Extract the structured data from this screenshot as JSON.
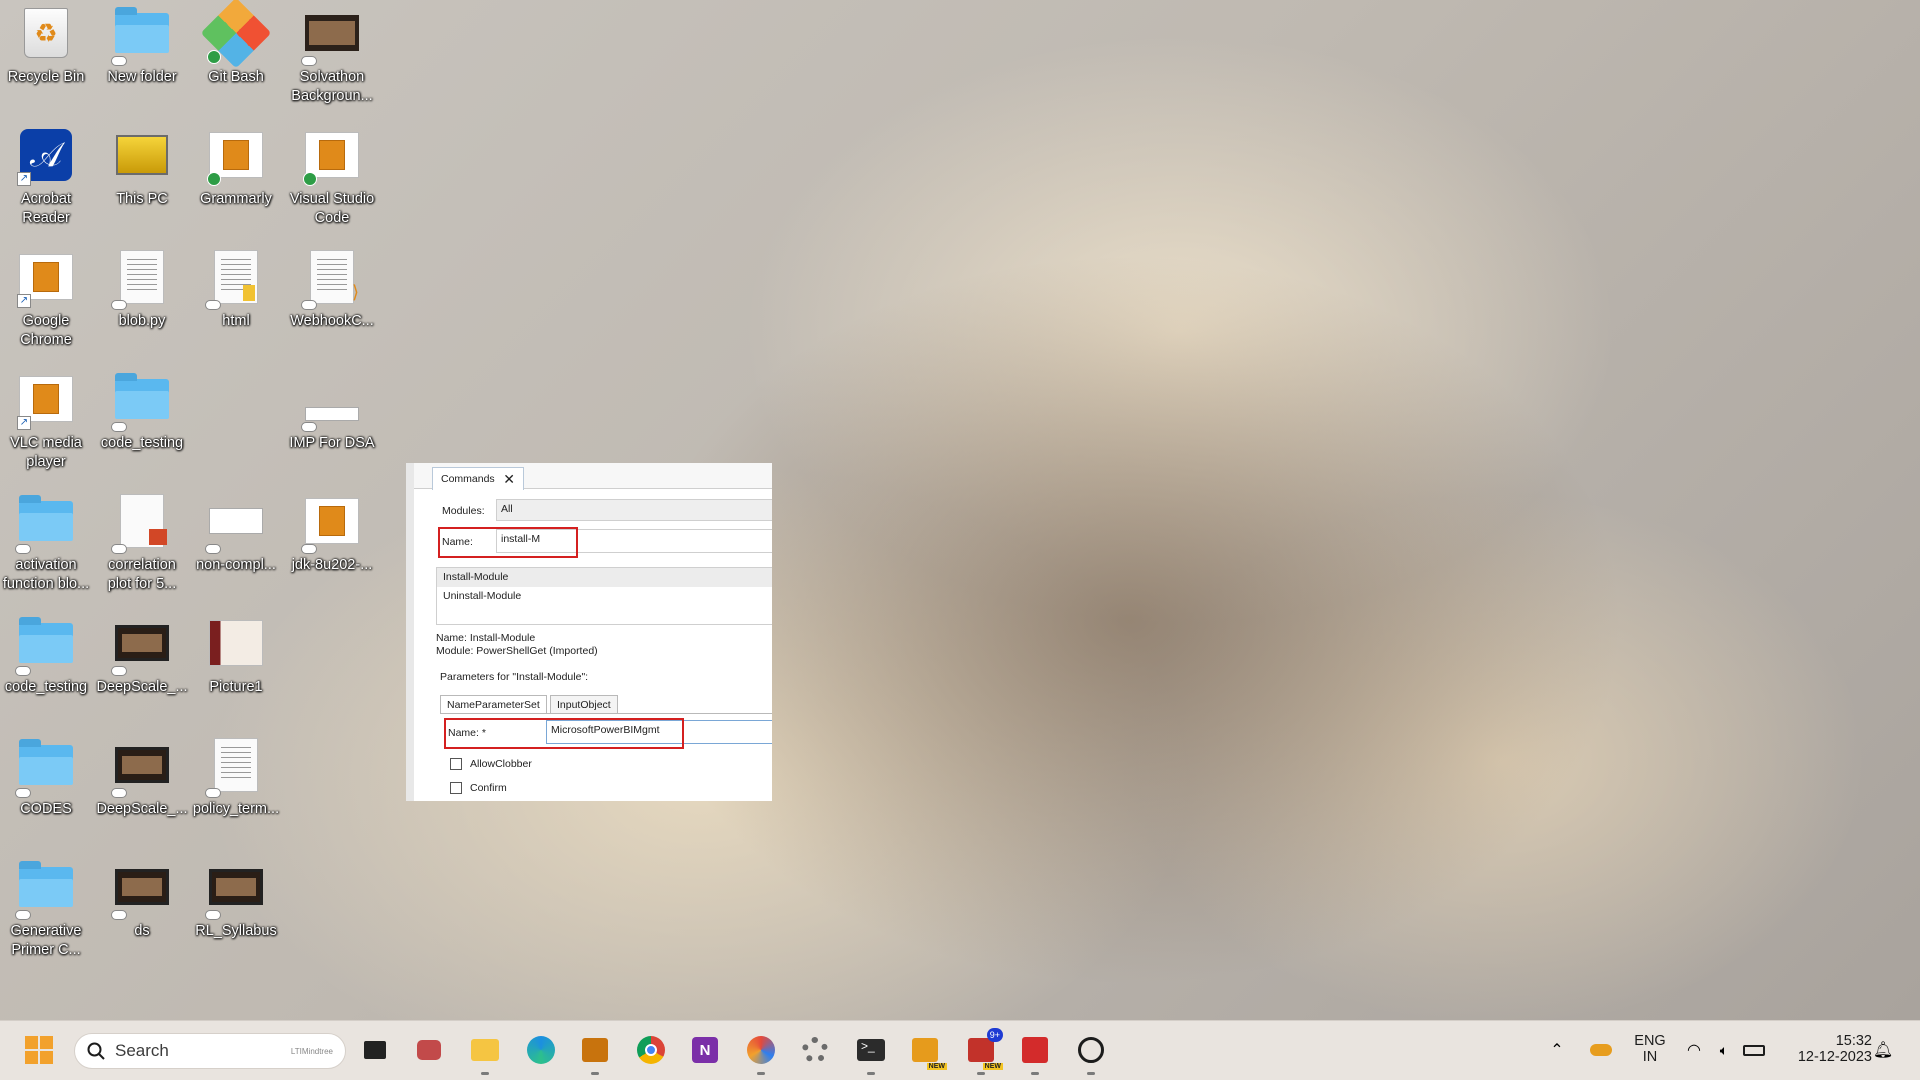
{
  "desktop": {
    "icons": [
      {
        "label": "Recycle Bin"
      },
      {
        "label": "New folder"
      },
      {
        "label": "Git Bash"
      },
      {
        "label": "Solvathon Backgroun..."
      },
      {
        "label": "Acrobat Reader"
      },
      {
        "label": "This PC"
      },
      {
        "label": "Grammarly"
      },
      {
        "label": "Visual Studio Code"
      },
      {
        "label": "Google Chrome"
      },
      {
        "label": "blob.py"
      },
      {
        "label": "html"
      },
      {
        "label": "WebhookC..."
      },
      {
        "label": "VLC media player"
      },
      {
        "label": "code_testing"
      },
      {
        "label": "IMP For DSA"
      },
      {
        "label": "activation function blo..."
      },
      {
        "label": "correlation plot for 5..."
      },
      {
        "label": "non-compl..."
      },
      {
        "label": "jdk-8u202-..."
      },
      {
        "label": "code_testing"
      },
      {
        "label": "DeepScale_..."
      },
      {
        "label": "Picture1"
      },
      {
        "label": "CODES"
      },
      {
        "label": "DeepScale_..."
      },
      {
        "label": "policy_term..."
      },
      {
        "label": "Generative Primer C..."
      },
      {
        "label": "ds"
      },
      {
        "label": "RL_Syllabus"
      }
    ]
  },
  "commands_panel": {
    "tab_label": "Commands",
    "modules_label": "Modules:",
    "modules_value": "All",
    "name_label": "Name:",
    "name_value": "install-M",
    "results": [
      "Install-Module",
      "Uninstall-Module"
    ],
    "detail_name": "Name: Install-Module",
    "detail_module": "Module: PowerShellGet (Imported)",
    "parameters_heading": "Parameters for \"Install-Module\":",
    "param_tabs": [
      "NameParameterSet",
      "InputObject"
    ],
    "param_name_label": "Name: *",
    "param_name_value": "MicrosoftPowerBIMgmt",
    "checkboxes": [
      "AllowClobber",
      "Confirm"
    ]
  },
  "taskbar": {
    "search_placeholder": "Search",
    "search_badge": "LTIMindtree",
    "apps": [
      {
        "icon": "task-view-icon"
      },
      {
        "icon": "teams-icon"
      },
      {
        "icon": "file-explorer-icon"
      },
      {
        "icon": "edge-icon"
      },
      {
        "icon": "store-icon"
      },
      {
        "icon": "chrome-icon"
      },
      {
        "icon": "onenote-icon"
      },
      {
        "icon": "snipping-tool-icon"
      },
      {
        "icon": "settings-icon"
      },
      {
        "icon": "terminal-icon"
      },
      {
        "icon": "outlook-icon",
        "tag": "NEW"
      },
      {
        "icon": "teams-new-icon",
        "badge": "9+",
        "tag": "NEW"
      },
      {
        "icon": "acrobat-icon"
      },
      {
        "icon": "clock-app-icon"
      }
    ],
    "tray": {
      "language_line1": "ENG",
      "language_line2": "IN",
      "time": "15:32",
      "date": "12-12-2023"
    }
  },
  "colors": {
    "highlight_box": "#d42020",
    "windows_logo": "#f2a12c"
  }
}
